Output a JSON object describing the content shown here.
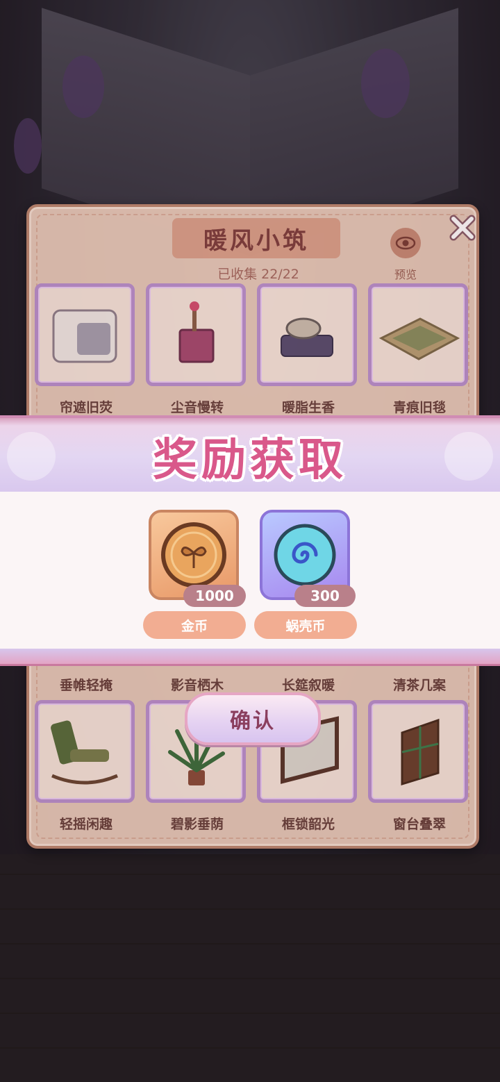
{
  "panel": {
    "title": "暖风小筑",
    "collected": "已收集 22/22",
    "preview_label": "预览",
    "row1": [
      "帘遮旧荧",
      "尘音慢转",
      "暖脂生香",
      "青痕旧毯"
    ],
    "row2": [
      "垂帷轻掩",
      "影音栖木",
      "长筵叙暖",
      "清茶几案"
    ],
    "row3": [
      "轻摇闲趣",
      "碧影垂荫",
      "框锁韶光",
      "窗台叠翠"
    ]
  },
  "reward": {
    "title": "奖励获取",
    "items": [
      {
        "name": "金币",
        "qty": "1000",
        "icon": "gold-coin-icon"
      },
      {
        "name": "蜗壳币",
        "qty": "300",
        "icon": "snail-shell-coin-icon"
      }
    ]
  },
  "confirm_label": "确认",
  "colors": {
    "title_pink": "#d9588a",
    "panel_bg": "#e3c2b2",
    "reward_name_bg": "#f2ad92",
    "card_border": "#b88bc6"
  }
}
